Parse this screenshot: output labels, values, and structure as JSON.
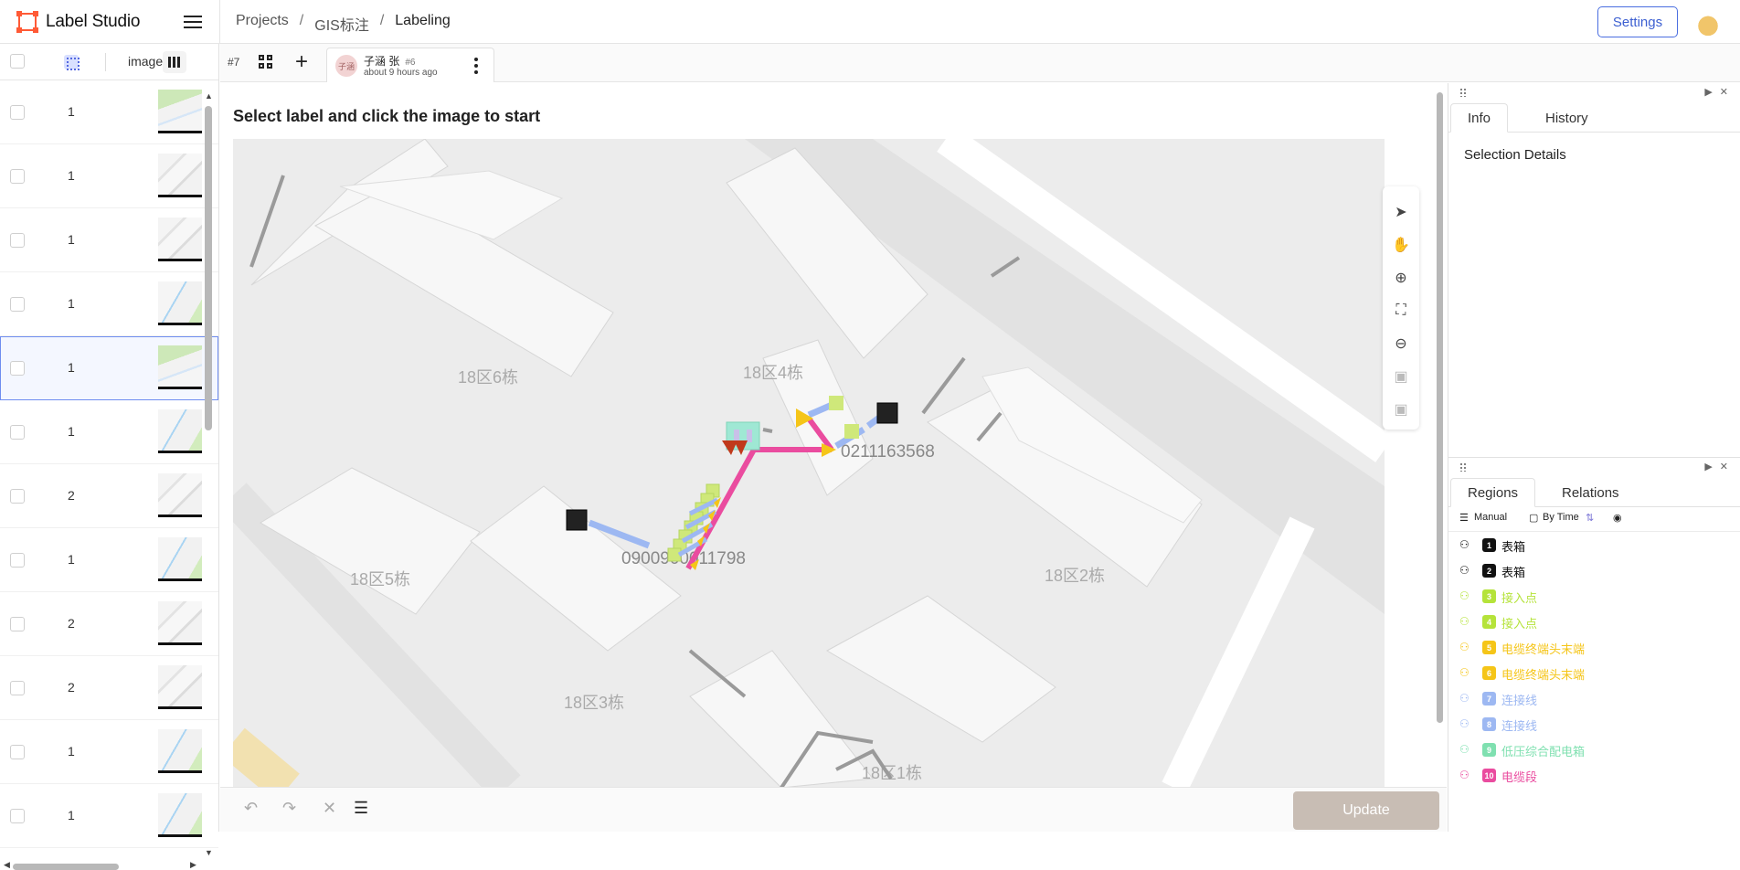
{
  "app": {
    "name": "Label Studio"
  },
  "breadcrumb": {
    "projects": "Projects",
    "project": "GIS标注",
    "page": "Labeling",
    "sep": "/"
  },
  "header": {
    "settings_label": "Settings"
  },
  "table": {
    "column_image": "image",
    "rows": [
      {
        "value": "1"
      },
      {
        "value": "1"
      },
      {
        "value": "1"
      },
      {
        "value": "1"
      },
      {
        "value": "1"
      },
      {
        "value": "1"
      },
      {
        "value": "2"
      },
      {
        "value": "1"
      },
      {
        "value": "2"
      },
      {
        "value": "2"
      },
      {
        "value": "1"
      },
      {
        "value": "1"
      }
    ],
    "selected_row": 4
  },
  "task": {
    "id": "#7"
  },
  "annotation": {
    "user": "子涵 张",
    "number": "#6",
    "time": "about 9 hours ago",
    "avatar": "子涵"
  },
  "main": {
    "instruction": "Select label and click the image to start"
  },
  "map": {
    "labels": [
      "18区6栋",
      "18区4栋",
      "18区5栋",
      "18区2栋",
      "18区3栋",
      "18区1栋"
    ],
    "ids": [
      "0211163568",
      "0900900011798"
    ]
  },
  "bottom": {
    "update_label": "Update"
  },
  "side": {
    "info_tab": "Info",
    "history_tab": "History",
    "selection_details": "Selection Details",
    "regions_tab": "Regions",
    "relations_tab": "Relations",
    "sort_manual": "Manual",
    "sort_by_time": "By Time"
  },
  "regions": [
    {
      "num": "1",
      "label": "表箱",
      "color": "#111111",
      "text_color": "#111111"
    },
    {
      "num": "2",
      "label": "表箱",
      "color": "#111111",
      "text_color": "#111111"
    },
    {
      "num": "3",
      "label": "接入点",
      "color": "#b5e33a",
      "text_color": "#b5e33a"
    },
    {
      "num": "4",
      "label": "接入点",
      "color": "#b5e33a",
      "text_color": "#b5e33a"
    },
    {
      "num": "5",
      "label": "电缆终端头末端",
      "color": "#f5c518",
      "text_color": "#f5c518"
    },
    {
      "num": "6",
      "label": "电缆终端头末端",
      "color": "#f5c518",
      "text_color": "#f5c518"
    },
    {
      "num": "7",
      "label": "连接线",
      "color": "#9db8f2",
      "text_color": "#9db8f2"
    },
    {
      "num": "8",
      "label": "连接线",
      "color": "#9db8f2",
      "text_color": "#9db8f2"
    },
    {
      "num": "9",
      "label": "低压综合配电箱",
      "color": "#7fe0b0",
      "text_color": "#7fe0b0"
    },
    {
      "num": "10",
      "label": "电缆段",
      "color": "#ea4c9f",
      "text_color": "#ea4c9f"
    }
  ]
}
